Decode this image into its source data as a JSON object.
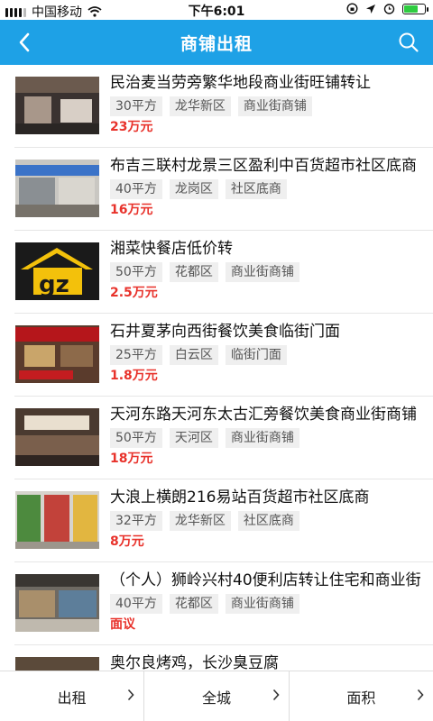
{
  "status_bar": {
    "carrier": "中国移动",
    "time": "下午6:01"
  },
  "header": {
    "title": "商铺出租",
    "back_icon": "back-arrow-icon",
    "search_icon": "search-icon"
  },
  "listings": [
    {
      "title": "民治麦当劳旁繁华地段商业街旺铺转让",
      "area": "30平方",
      "district": "龙华新区",
      "type": "商业街商铺",
      "price": "23万元"
    },
    {
      "title": "布吉三联村龙景三区盈利中百货超市社区底商",
      "area": "40平方",
      "district": "龙岗区",
      "type": "社区底商",
      "price": "16万元"
    },
    {
      "title": "湘菜快餐店低价转",
      "area": "50平方",
      "district": "花都区",
      "type": "商业街商铺",
      "price": "2.5万元"
    },
    {
      "title": "石井夏茅向西街餐饮美食临街门面",
      "area": "25平方",
      "district": "白云区",
      "type": "临街门面",
      "price": "1.8万元"
    },
    {
      "title": "天河东路天河东太古汇旁餐饮美食商业街商铺",
      "area": "50平方",
      "district": "天河区",
      "type": "商业街商铺",
      "price": "18万元"
    },
    {
      "title": "大浪上横朗216易站百货超市社区底商",
      "area": "32平方",
      "district": "龙华新区",
      "type": "社区底商",
      "price": "8万元"
    },
    {
      "title": "（个人）狮岭兴村40便利店转让住宅和商业街",
      "area": "40平方",
      "district": "花都区",
      "type": "商业街商铺",
      "price": "面议"
    },
    {
      "title": "奥尔良烤鸡，长沙臭豆腐",
      "area": "",
      "district": "",
      "type": "",
      "price": ""
    }
  ],
  "filters": [
    {
      "label": "出租"
    },
    {
      "label": "全城"
    },
    {
      "label": "面积"
    }
  ],
  "colors": {
    "header_bg": "#1ea1e6",
    "price": "#e8322b",
    "tag_bg": "#efefef"
  }
}
